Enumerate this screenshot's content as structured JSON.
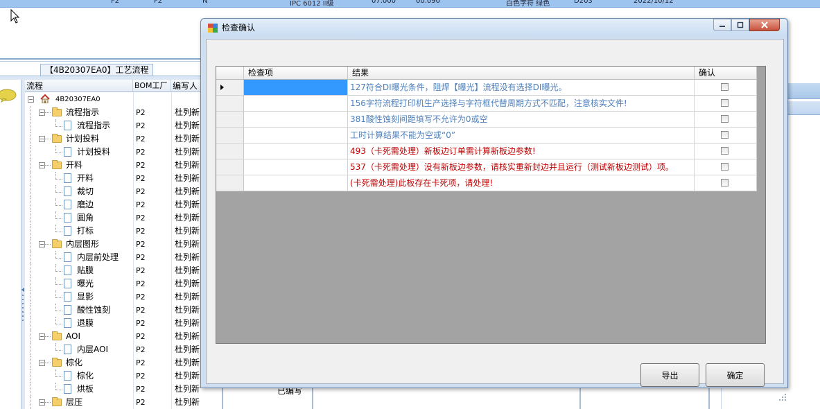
{
  "top_strip": [
    "F2",
    "F2",
    "N",
    "IPC 6012 II级",
    "07.000",
    "00.090",
    "白色字符 绿色",
    "D203",
    "2022/10/12"
  ],
  "background": {
    "process_tab": "【4B20307EA0】工艺流程",
    "tree_columns": [
      "流程",
      "BOM工厂",
      "编写人"
    ],
    "tree_rows": [
      {
        "label": "4B20307EA0",
        "level": 0,
        "type": "root",
        "bom": "",
        "writer": ""
      },
      {
        "label": "流程指示",
        "level": 1,
        "type": "folder",
        "bom": "P2",
        "writer": "杜列新"
      },
      {
        "label": "流程指示",
        "level": 2,
        "type": "doc",
        "bom": "P2",
        "writer": "杜列新"
      },
      {
        "label": "计划投料",
        "level": 1,
        "type": "folder",
        "bom": "P2",
        "writer": "杜列新"
      },
      {
        "label": "计划投料",
        "level": 2,
        "type": "doc",
        "bom": "P2",
        "writer": "杜列新"
      },
      {
        "label": "开料",
        "level": 1,
        "type": "folder",
        "bom": "P2",
        "writer": "杜列新"
      },
      {
        "label": "开料",
        "level": 2,
        "type": "doc",
        "bom": "P2",
        "writer": "杜列新"
      },
      {
        "label": "裁切",
        "level": 2,
        "type": "doc",
        "bom": "P2",
        "writer": "杜列新"
      },
      {
        "label": "磨边",
        "level": 2,
        "type": "doc",
        "bom": "P2",
        "writer": "杜列新"
      },
      {
        "label": "圆角",
        "level": 2,
        "type": "doc",
        "bom": "P2",
        "writer": "杜列新"
      },
      {
        "label": "打标",
        "level": 2,
        "type": "doc",
        "bom": "P2",
        "writer": "杜列新"
      },
      {
        "label": "内层图形",
        "level": 1,
        "type": "folder",
        "bom": "P2",
        "writer": "杜列新"
      },
      {
        "label": "内层前处理",
        "level": 2,
        "type": "doc",
        "bom": "P2",
        "writer": "杜列新"
      },
      {
        "label": "贴膜",
        "level": 2,
        "type": "doc",
        "bom": "P2",
        "writer": "杜列新"
      },
      {
        "label": "曝光",
        "level": 2,
        "type": "doc",
        "bom": "P2",
        "writer": "杜列新"
      },
      {
        "label": "显影",
        "level": 2,
        "type": "doc",
        "bom": "P2",
        "writer": "杜列新"
      },
      {
        "label": "酸性蚀刻",
        "level": 2,
        "type": "doc",
        "bom": "P2",
        "writer": "杜列新"
      },
      {
        "label": "退膜",
        "level": 2,
        "type": "doc",
        "bom": "P2",
        "writer": "杜列新"
      },
      {
        "label": "AOI",
        "level": 1,
        "type": "folder",
        "bom": "P2",
        "writer": "杜列新"
      },
      {
        "label": "内层AOI",
        "level": 2,
        "type": "doc",
        "bom": "P2",
        "writer": "杜列新"
      },
      {
        "label": "棕化",
        "level": 1,
        "type": "folder",
        "bom": "P2",
        "writer": "杜列新"
      },
      {
        "label": "棕化",
        "level": 2,
        "type": "doc",
        "bom": "P2",
        "writer": "杜列新"
      },
      {
        "label": "烘板",
        "level": 2,
        "type": "doc",
        "bom": "P2",
        "writer": "杜列新"
      },
      {
        "label": "层压",
        "level": 1,
        "type": "folder",
        "bom": "P2",
        "writer": "杜列新"
      }
    ],
    "bottom_text": "已编写"
  },
  "dialog": {
    "title": "检查确认",
    "columns": [
      "检查项",
      "结果",
      "确认"
    ],
    "rows": [
      {
        "item": "",
        "result": "127符合DI曝光条件，阻焊【曝光】流程没有选择DI曝光。",
        "color": "#4f81bd",
        "checked": false,
        "current": true
      },
      {
        "item": "",
        "result": "156字符流程打印机生产选择与字符框代替周期方式不匹配，注意核实文件!",
        "color": "#4f81bd",
        "checked": false,
        "current": false
      },
      {
        "item": "",
        "result": "381酸性蚀刻间距填写不允许为0或空",
        "color": "#4f81bd",
        "checked": false,
        "current": false
      },
      {
        "item": "",
        "result": "工时计算结果不能为空或“0”",
        "color": "#4f81bd",
        "checked": false,
        "current": false
      },
      {
        "item": "",
        "result": "493（卡死需处理）新板边订单需计算新板边参数!",
        "color": "#c00000",
        "checked": false,
        "current": false
      },
      {
        "item": "",
        "result": "537（卡死需处理）没有新板边参数，请核实重新封边并且运行（测试新板边测试）项。",
        "color": "#c00000",
        "checked": false,
        "current": false
      },
      {
        "item": "",
        "result": "(卡死需处理)此板存在卡死项，请处理!",
        "color": "#c00000",
        "checked": false,
        "current": false
      }
    ],
    "export_label": "导出",
    "ok_label": "确定"
  }
}
